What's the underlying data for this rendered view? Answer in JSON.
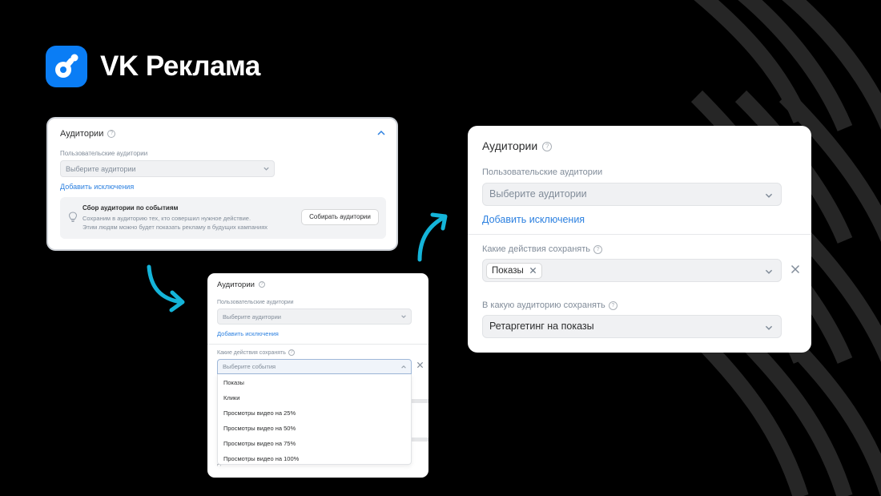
{
  "brand": {
    "name": "VK Реклама",
    "logo_icon": "vk-ads-logo",
    "accent": "#0a7df5"
  },
  "card_a": {
    "title": "Аудитории",
    "field_label": "Пользовательские аудитории",
    "select_placeholder": "Выберите аудитории",
    "add_exclusions_link": "Добавить исключения",
    "collect_box": {
      "title": "Сбор аудитории по событиям",
      "description_line1": "Сохраним в аудиторию тех, кто совершил нужное действие.",
      "description_line2": "Этим людям можно будет показать рекламу в будущих кампаниях",
      "button_label": "Собирать аудитории"
    }
  },
  "card_b": {
    "title": "Аудитории",
    "field_label": "Пользовательские аудитории",
    "select_placeholder": "Выберите аудитории",
    "add_exclusions_link": "Добавить исключения",
    "actions_label": "Какие действия сохранять",
    "events_placeholder": "Выберите события",
    "options": [
      "Показы",
      "Клики",
      "Просмотры видео на 25%",
      "Просмотры видео на 50%",
      "Просмотры видео на 75%",
      "Просмотры видео на 100%"
    ],
    "background_text": "Добавить UTM-метки автоматически"
  },
  "card_c": {
    "title": "Аудитории",
    "field_label": "Пользовательские аудитории",
    "select_placeholder": "Выберите аудитории",
    "add_exclusions_link": "Добавить исключения",
    "actions_label": "Какие действия сохранять",
    "selected_chip": "Показы",
    "target_audience_label": "В какую аудиторию сохранять",
    "target_audience_value": "Ретаргетинг на показы"
  },
  "colors": {
    "link": "#2d81e0",
    "arrow": "#14b4d9",
    "text_secondary": "#818c99"
  }
}
